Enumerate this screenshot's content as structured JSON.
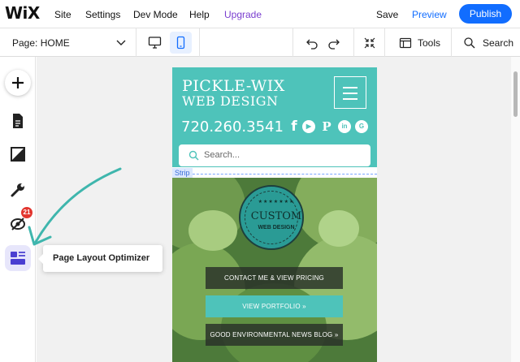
{
  "topbar": {
    "logo": "WiX",
    "menu": [
      "Site",
      "Settings",
      "Dev Mode",
      "Help",
      "Upgrade"
    ],
    "save_label": "Save",
    "preview_label": "Preview",
    "publish_label": "Publish"
  },
  "toolbar": {
    "page_label": "Page: HOME",
    "tools_label": "Tools",
    "search_label": "Search",
    "active_device": "mobile"
  },
  "sidebar": {
    "items": [
      "add",
      "pages",
      "design",
      "settings",
      "hide",
      "page-layout-optimizer"
    ],
    "badge_count": "21"
  },
  "tooltip": {
    "text": "Page Layout Optimizer"
  },
  "mobile_site": {
    "brand_line1": "PICKLE-WIX",
    "brand_line2": "WEB DESIGN",
    "phone": "720.260.3541",
    "search_placeholder": "Search...",
    "strip_label": "Strip",
    "seal_main": "CUSTOM",
    "seal_sub": "WEB DESIGN",
    "buttons": [
      "CONTACT ME & VIEW PRICING",
      "VIEW PORTFOLIO »",
      "GOOD ENVIRONMENTAL NEWS BLOG »"
    ]
  },
  "colors": {
    "accent": "#116dff",
    "site_teal": "#4ec3ba",
    "upgrade": "#7a3fcf",
    "badge": "#e2362f",
    "arrow": "#3fb6ad"
  }
}
